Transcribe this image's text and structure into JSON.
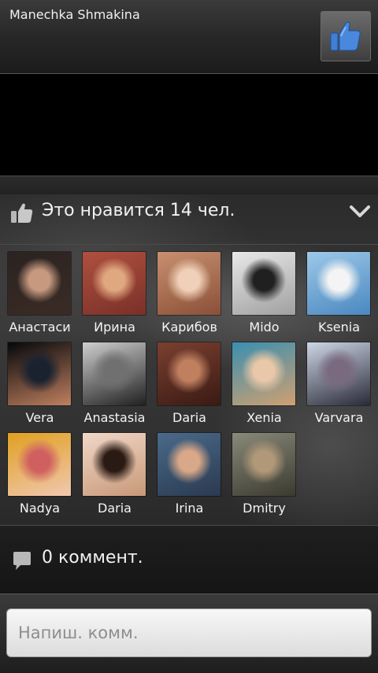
{
  "post": {
    "author": "Manechka Shmakina"
  },
  "likes": {
    "summary": "Это нравится 14 чел.",
    "people": [
      {
        "name": "Анастаси",
        "avatar_colors": [
          "#2a2320",
          "#c79a80",
          "#3b2b26"
        ]
      },
      {
        "name": "Ирина",
        "avatar_colors": [
          "#b05040",
          "#e0a880",
          "#7a3028"
        ]
      },
      {
        "name": "Карибов",
        "avatar_colors": [
          "#c89070",
          "#f0d0b8",
          "#8a5038"
        ]
      },
      {
        "name": "Mido",
        "avatar_colors": [
          "#e8e8e8",
          "#202020",
          "#a0a0a0"
        ]
      },
      {
        "name": "Ksenia",
        "avatar_colors": [
          "#9ec8e8",
          "#f4f4f4",
          "#4a88c0"
        ]
      },
      {
        "name": "Vera",
        "avatar_colors": [
          "#05070a",
          "#1a2230",
          "#c08060"
        ]
      },
      {
        "name": "Anastasia",
        "avatar_colors": [
          "#cfcfcf",
          "#707070",
          "#202020"
        ]
      },
      {
        "name": "Daria",
        "avatar_colors": [
          "#7a4030",
          "#c08060",
          "#3a1a14"
        ]
      },
      {
        "name": "Xenia",
        "avatar_colors": [
          "#3a8fb0",
          "#e8c8a8",
          "#d0a070"
        ]
      },
      {
        "name": "Varvara",
        "avatar_colors": [
          "#cdd6e6",
          "#7a6a80",
          "#2a2a38"
        ]
      },
      {
        "name": "Nadya",
        "avatar_colors": [
          "#e0a020",
          "#d06060",
          "#f0c8b0"
        ]
      },
      {
        "name": "Daria",
        "avatar_colors": [
          "#f0d8c8",
          "#2a1a14",
          "#c89878"
        ]
      },
      {
        "name": "Irina",
        "avatar_colors": [
          "#4a6a8a",
          "#d8a888",
          "#2a3a50"
        ]
      },
      {
        "name": "Dmitry",
        "avatar_colors": [
          "#8a8a7a",
          "#b09878",
          "#3a3a30"
        ]
      }
    ]
  },
  "comments": {
    "summary": "0 коммент."
  },
  "compose": {
    "placeholder": "Напиш. комм."
  },
  "icons": {
    "like": "thumbs-up-icon",
    "expand": "chevron-down-icon",
    "comment": "speech-bubble-icon"
  },
  "colors": {
    "like_blue": "#3f7fd6"
  }
}
